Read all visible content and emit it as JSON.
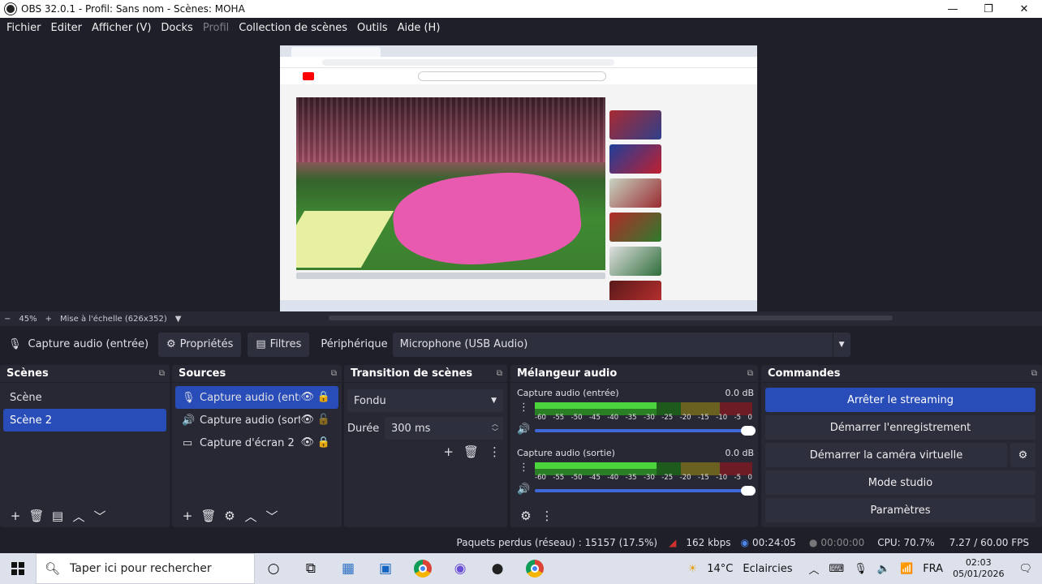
{
  "window": {
    "title": "OBS 32.0.1 - Profil: Sans nom - Scènes: MOHA",
    "minimize": "—",
    "maximize": "❐",
    "close": "✕"
  },
  "menu": [
    "Fichier",
    "Editer",
    "Afficher (V)",
    "Docks",
    "Profil",
    "Collection de scènes",
    "Outils",
    "Aide (H)"
  ],
  "zoom": {
    "minus": "−",
    "level": "45%",
    "plus": "+",
    "scale_label": "Mise à l'échelle (626x352)",
    "dropdown": "▼"
  },
  "context": {
    "source_name": "Capture audio (entrée)",
    "properties_label": "Propriétés",
    "filters_label": "Filtres",
    "device_label": "Périphérique",
    "device_value": "Microphone (USB Audio)"
  },
  "scenes": {
    "title": "Scènes",
    "items": [
      "Scène",
      "Scène 2"
    ],
    "selected_index": 1
  },
  "sources": {
    "title": "Sources",
    "items": [
      {
        "name": "Capture audio (entrée)",
        "icon": "microphone-icon",
        "selected": true
      },
      {
        "name": "Capture audio (sortie)",
        "icon": "speaker-icon",
        "selected": false
      },
      {
        "name": "Capture d'écran 2",
        "icon": "monitor-icon",
        "selected": false
      }
    ]
  },
  "transitions": {
    "title": "Transition de scènes",
    "type_value": "Fondu",
    "duration_label": "Durée",
    "duration_value": "300 ms"
  },
  "mixer": {
    "title": "Mélangeur audio",
    "ticks": [
      "-60",
      "-55",
      "-50",
      "-45",
      "-40",
      "-35",
      "-30",
      "-25",
      "-20",
      "-15",
      "-10",
      "-5",
      "0"
    ],
    "channels": [
      {
        "name": "Capture audio (entrée)",
        "db": "0.0 dB",
        "volume": 1.0
      },
      {
        "name": "Capture audio (sortie)",
        "db": "0.0 dB",
        "volume": 1.0
      }
    ]
  },
  "commands": {
    "title": "Commandes",
    "stop_streaming": "Arrêter le streaming",
    "start_recording": "Démarrer l'enregistrement",
    "start_virtual_camera": "Démarrer la caméra virtuelle",
    "studio_mode": "Mode studio",
    "settings": "Paramètres"
  },
  "status": {
    "dropped_frames": "Paquets perdus (réseau) : 15157 (17.5%)",
    "bitrate": "162 kbps",
    "stream_time": "00:24:05",
    "record_time": "00:00:00",
    "cpu": "CPU: 70.7%",
    "fps": "7.27 / 60.00 FPS"
  },
  "taskbar": {
    "search_placeholder": "Taper ici pour rechercher",
    "weather_temp": "14°C",
    "weather_desc": "Eclaircies",
    "language": "FRA",
    "time": "02:03",
    "date": "05/01/2026"
  },
  "colors": {
    "accent": "#284cb8",
    "background": "#1e1f29",
    "panel": "#272834"
  }
}
